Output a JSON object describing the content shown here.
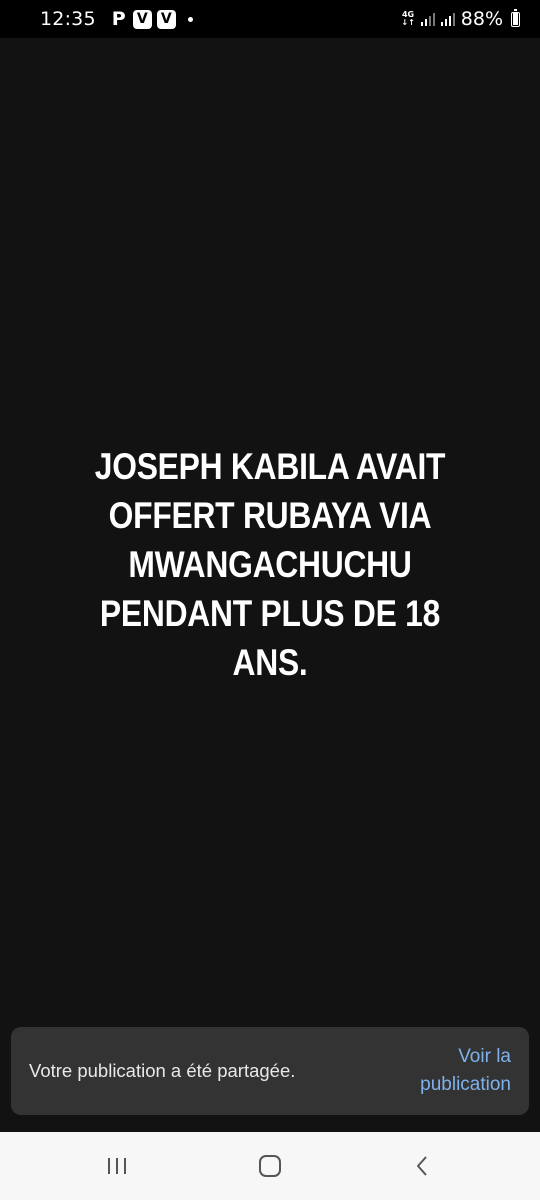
{
  "status_bar": {
    "time": "12:35",
    "notification_icons": [
      "P",
      "V",
      "V"
    ],
    "network_label": "4G",
    "battery_percent": "88%"
  },
  "post": {
    "text": "JOSEPH KABILA AVAIT\nOFFERT RUBAYA VIA\nMWANGACHUCHU\nPENDANT PLUS DE 18\nANS."
  },
  "snackbar": {
    "message": "Votre publication a été partagée.",
    "action_label": "Voir la publication"
  },
  "nav": {
    "icons": [
      "recent-apps-icon",
      "home-icon",
      "back-icon"
    ]
  },
  "colors": {
    "background": "#121212",
    "snackbar": "#333333",
    "action": "#7fb1ec",
    "nav_bar": "#f7f7f7"
  }
}
